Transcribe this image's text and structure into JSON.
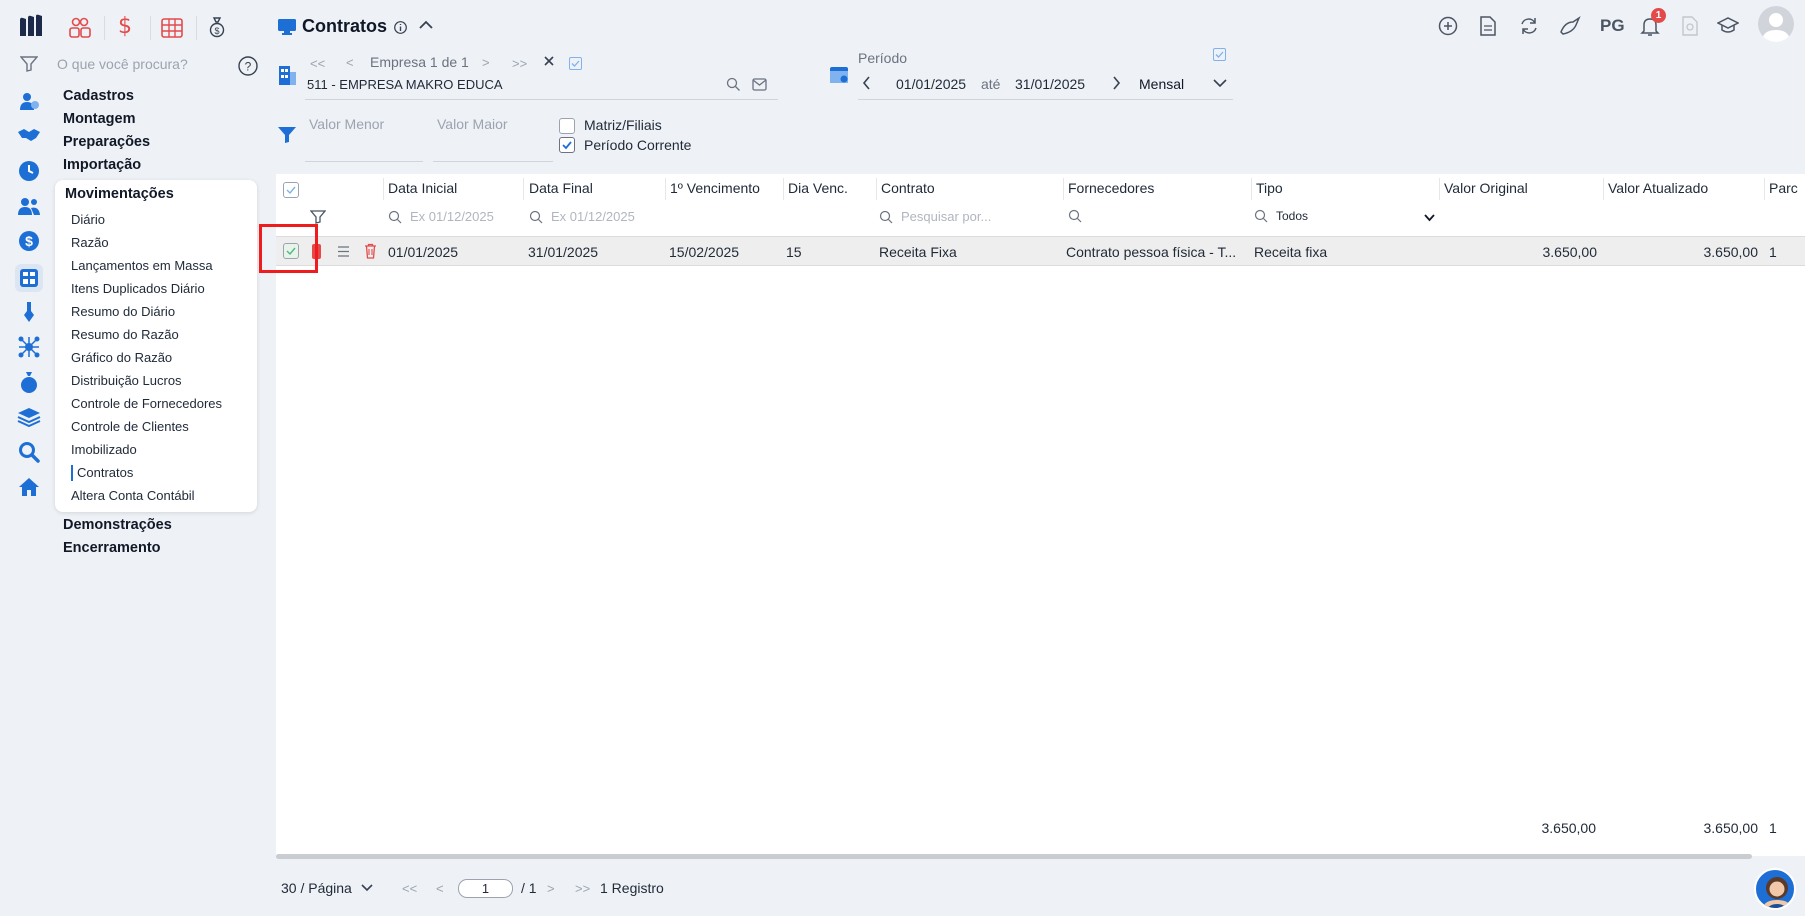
{
  "app": {
    "page_title": "Contratos",
    "search_placeholder": "O que você procura?"
  },
  "menu": {
    "sections_top": [
      "Cadastros",
      "Montagem",
      "Preparações",
      "Importação"
    ],
    "submenu_title": "Movimentações",
    "submenu_items": [
      "Diário",
      "Razão",
      "Lançamentos em Massa",
      "Itens Duplicados Diário",
      "Resumo do Diário",
      "Resumo do Razão",
      "Gráfico do Razão",
      "Distribuição Lucros",
      "Controle de Fornecedores",
      "Controle de Clientes",
      "Imobilizado",
      "Contratos",
      "Altera Conta Contábil"
    ],
    "selected_item": "Contratos",
    "sections_bottom": [
      "Demonstrações",
      "Encerramento"
    ]
  },
  "company": {
    "pager_label": "Empresa 1 de 1",
    "name": "511 - EMPRESA MAKRO EDUCA"
  },
  "period": {
    "label": "Período",
    "start": "01/01/2025",
    "separator": "até",
    "end": "31/01/2025",
    "mode": "Mensal"
  },
  "filters": {
    "valor_menor": "Valor Menor",
    "valor_maior": "Valor Maior",
    "matriz_filiais": "Matriz/Filiais",
    "periodo_corrente": "Período Corrente"
  },
  "topbar": {
    "user_initials": "PG",
    "notification_count": "1"
  },
  "grid": {
    "columns": [
      "Data Inicial",
      "Data Final",
      "1º Vencimento",
      "Dia Venc.",
      "Contrato",
      "Fornecedores",
      "Tipo",
      "Valor Original",
      "Valor Atualizado",
      "Parc"
    ],
    "filter_placeholders": {
      "date_inicial": "Ex 01/12/2025",
      "date_final": "Ex 01/12/2025",
      "contrato": "Pesquisar por...",
      "tipo": "Todos"
    },
    "rows": [
      {
        "data_inicial": "01/01/2025",
        "data_final": "31/01/2025",
        "vencimento": "15/02/2025",
        "dia_venc": "15",
        "contrato": "Receita Fixa",
        "fornecedores": "Contrato pessoa física - T...",
        "tipo": "Receita fixa",
        "valor_original": "3.650,00",
        "valor_atualizado": "3.650,00",
        "parc": "1"
      }
    ],
    "totals": {
      "valor_original": "3.650,00",
      "valor_atualizado": "3.650,00",
      "parc": "1"
    }
  },
  "pagination": {
    "page_size": "30 / Página",
    "current_page": "1",
    "total_pages": "/ 1",
    "records": "1 Registro"
  }
}
